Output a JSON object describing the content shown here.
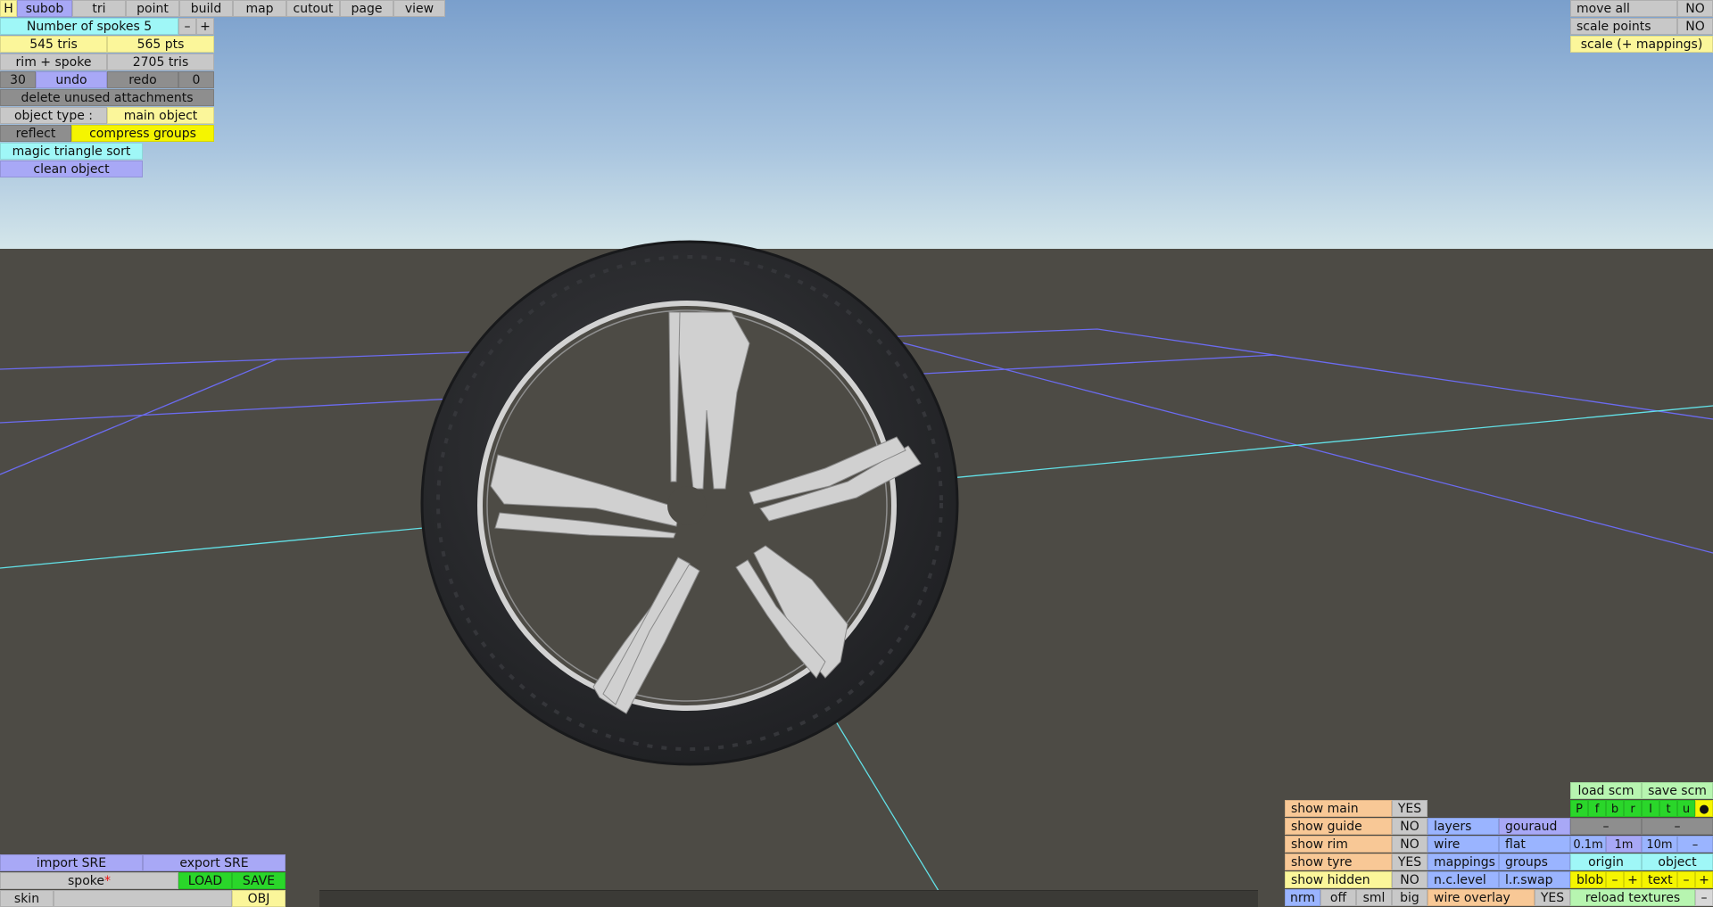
{
  "menu": {
    "h": "H",
    "tabs": [
      "subob",
      "tri",
      "point",
      "build",
      "map",
      "cutout",
      "page",
      "view"
    ]
  },
  "left_panel": {
    "spokes_label": "Number of spokes 5",
    "minus": "–",
    "plus": "+",
    "tris": "545 tris",
    "pts": "565 pts",
    "rim_spoke": "rim + spoke",
    "total_tris": "2705 tris",
    "undo_count": "30",
    "undo": "undo",
    "redo": "redo",
    "redo_count": "0",
    "delete_unused": "delete unused attachments",
    "object_type_label": "object type :",
    "object_type_value": "main object",
    "reflect": "reflect",
    "compress_groups": "compress groups",
    "magic_sort": "magic triangle sort",
    "clean_object": "clean object"
  },
  "top_right": {
    "move_all": "move all",
    "move_all_value": "NO",
    "scale_points": "scale points",
    "scale_points_value": "NO",
    "scale_mappings": "scale (+ mappings)"
  },
  "bottom_left": {
    "import_sre": "import SRE",
    "export_sre": "export SRE",
    "name": "spoke",
    "name_mark": "*",
    "load": "LOAD",
    "save": "SAVE",
    "skin": "skin",
    "skin_value": "",
    "obj": "OBJ"
  },
  "bottom_right": {
    "show_main": "show main",
    "show_main_value": "YES",
    "show_guide": "show guide",
    "show_guide_value": "NO",
    "show_rim": "show rim",
    "show_rim_value": "NO",
    "show_tyre": "show tyre",
    "show_tyre_value": "YES",
    "show_hidden": "show hidden",
    "show_hidden_value": "NO",
    "layers": "layers",
    "gouraud": "gouraud",
    "wire": "wire",
    "flat": "flat",
    "mappings": "mappings",
    "groups": "groups",
    "nc_level": "n.c.level",
    "lr_swap": "l.r.swap",
    "wire_overlay": "wire overlay",
    "wire_overlay_value": "YES",
    "view_sizes": [
      "nrm",
      "off",
      "sml",
      "big"
    ],
    "load_scm": "load scm",
    "save_scm": "save scm",
    "flags": [
      "P",
      "f",
      "b",
      "r",
      "l",
      "t",
      "u"
    ],
    "dot": "●",
    "dash": "–",
    "scales": [
      "0.1m",
      "1m",
      "10m"
    ],
    "origin": "origin",
    "object": "object",
    "blob": "blob",
    "text": "text",
    "reload_textures": "reload textures"
  },
  "colors": {
    "sky_top": "#7a9fcc",
    "sky_horizon": "#cfe3e8",
    "ground": "#4d4b45",
    "tyre": "#2a2b2d",
    "rim": "#cfcfcf",
    "guide_blue": "#6b6bf0",
    "guide_cyan": "#62e0e6"
  }
}
